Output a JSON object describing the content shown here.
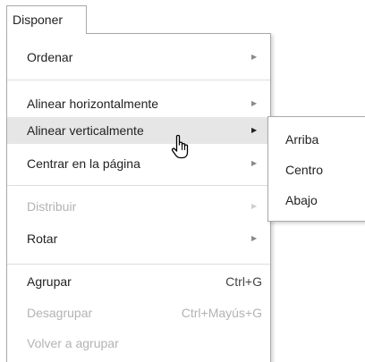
{
  "menubar": {
    "label": "Disponer"
  },
  "menu": {
    "items": [
      {
        "label": "Ordenar",
        "disabled": false,
        "has_submenu": true
      },
      {
        "label": "Alinear horizontalmente",
        "disabled": false,
        "has_submenu": true
      },
      {
        "label": "Alinear verticalmente",
        "disabled": false,
        "has_submenu": true,
        "highlighted": true
      },
      {
        "label": "Centrar en la página",
        "disabled": false,
        "has_submenu": true
      },
      {
        "label": "Distribuir",
        "disabled": true,
        "has_submenu": true
      },
      {
        "label": "Rotar",
        "disabled": false,
        "has_submenu": true
      },
      {
        "label": "Agrupar",
        "disabled": false,
        "shortcut": "Ctrl+G"
      },
      {
        "label": "Desagrupar",
        "disabled": true,
        "shortcut": "Ctrl+Mayús+G"
      },
      {
        "label": "Volver a agrupar",
        "disabled": true
      }
    ]
  },
  "submenu": {
    "items": [
      {
        "label": "Arriba"
      },
      {
        "label": "Centro"
      },
      {
        "label": "Abajo"
      }
    ]
  },
  "icons": {
    "submenu_arrow": "triangle-right-icon",
    "cursor": "hand-pointer-icon"
  },
  "colors": {
    "highlight_bg": "#e6e6e6",
    "disabled_text": "#b3b3b3",
    "border": "#a9a9a9"
  }
}
